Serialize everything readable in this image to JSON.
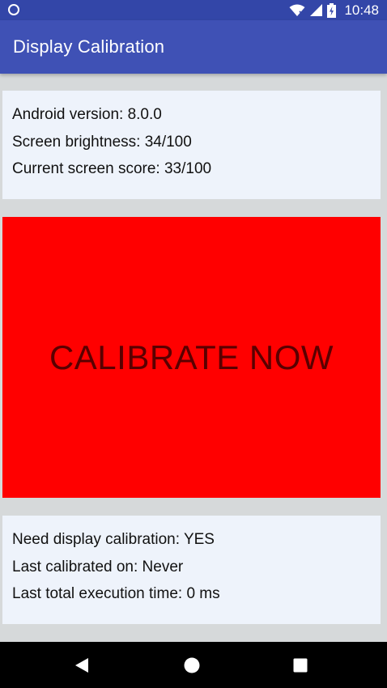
{
  "status_bar": {
    "time": "10:48",
    "icons": [
      "wifi-icon",
      "cell-signal-icon",
      "battery-icon"
    ],
    "background": "#3346a8"
  },
  "app_bar": {
    "title": "Display Calibration",
    "background": "#3f51b5"
  },
  "device_info": {
    "android_version": "Android version: 8.0.0",
    "screen_brightness": "Screen brightness: 34/100",
    "current_score": "Current screen score: 33/100"
  },
  "calibrate": {
    "label": "CALIBRATE NOW",
    "background": "#ff0000",
    "text_color": "#5a0000"
  },
  "calibration_status": {
    "need_calibration": "Need display calibration: YES",
    "last_calibrated": "Last calibrated on: Never",
    "last_execution_time": "Last total execution time: 0 ms"
  },
  "nav_bar": {
    "buttons": [
      "back-icon",
      "home-icon",
      "recents-icon"
    ]
  }
}
